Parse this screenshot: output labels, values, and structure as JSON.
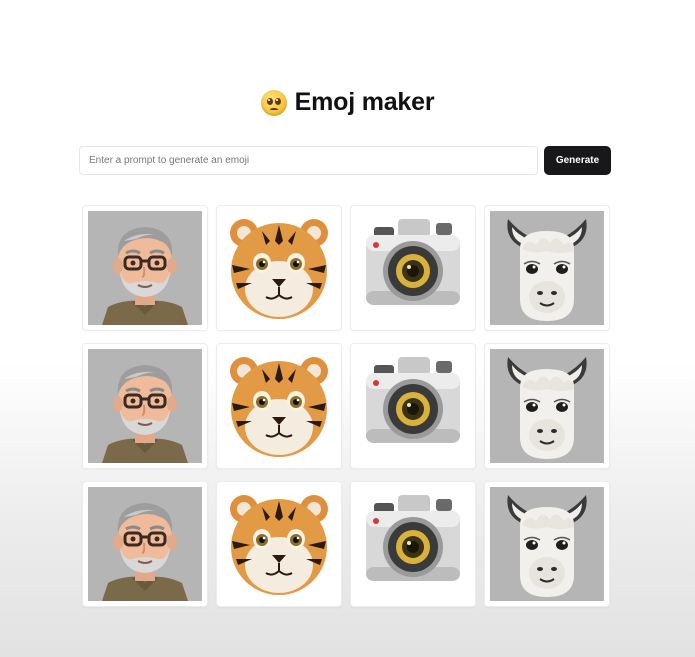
{
  "header": {
    "title": "Emoj maker",
    "icon": "pleading-face-emoji"
  },
  "prompt": {
    "placeholder": "Enter a prompt to generate an emoji",
    "value": "",
    "generate_label": "Generate"
  },
  "grid": {
    "rows": [
      [
        "man-with-glasses",
        "tiger-face",
        "camera",
        "llama-face"
      ],
      [
        "man-with-glasses",
        "tiger-face",
        "camera",
        "llama-face"
      ],
      [
        "man-with-glasses",
        "tiger-face",
        "camera",
        "llama-face"
      ]
    ]
  },
  "colors": {
    "button_bg": "#18181b",
    "button_text": "#ffffff",
    "card_border": "#ececec",
    "tile_gray": "#b8b8b8"
  }
}
